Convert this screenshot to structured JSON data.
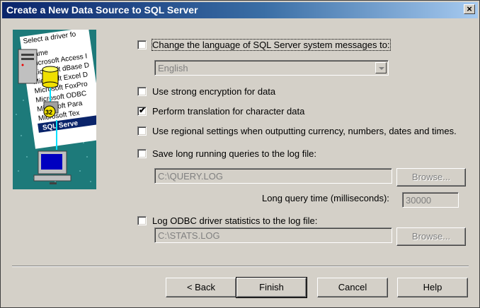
{
  "window": {
    "title": "Create a New Data Source to SQL Server",
    "close_glyph": "×"
  },
  "illustration": {
    "lines": [
      "Select a driver fo",
      "Name",
      "Microsoft Access I",
      "Microsoft dBase D",
      "Microsoft Excel D",
      "Microsoft FoxPro",
      "Microsoft ODBC",
      "Microsoft Para",
      "Microsoft Tex",
      "SQL Serve"
    ],
    "badge": "32"
  },
  "options": {
    "change_language": {
      "label": "Change the language of SQL Server system messages to:",
      "checked": false
    },
    "language_combo": {
      "value": "English"
    },
    "strong_encryption": {
      "label": "Use strong encryption for data",
      "checked": false
    },
    "perform_translation": {
      "label": "Perform translation for character data",
      "checked": true,
      "mark": "✔"
    },
    "regional_settings": {
      "label": "Use regional settings when outputting currency, numbers, dates and times.",
      "checked": false
    },
    "save_long_queries": {
      "label": "Save long running queries to the log file:",
      "checked": false
    },
    "query_log_path": "C:\\QUERY.LOG",
    "browse_query": "Browse...",
    "long_query_time_label": "Long query time (milliseconds):",
    "long_query_time": "30000",
    "log_driver_stats": {
      "label": "Log ODBC driver statistics to the log file:",
      "checked": false
    },
    "stats_log_path": "C:\\STATS.LOG",
    "browse_stats": "Browse..."
  },
  "buttons": {
    "back": "< Back",
    "finish": "Finish",
    "cancel": "Cancel",
    "help": "Help"
  }
}
